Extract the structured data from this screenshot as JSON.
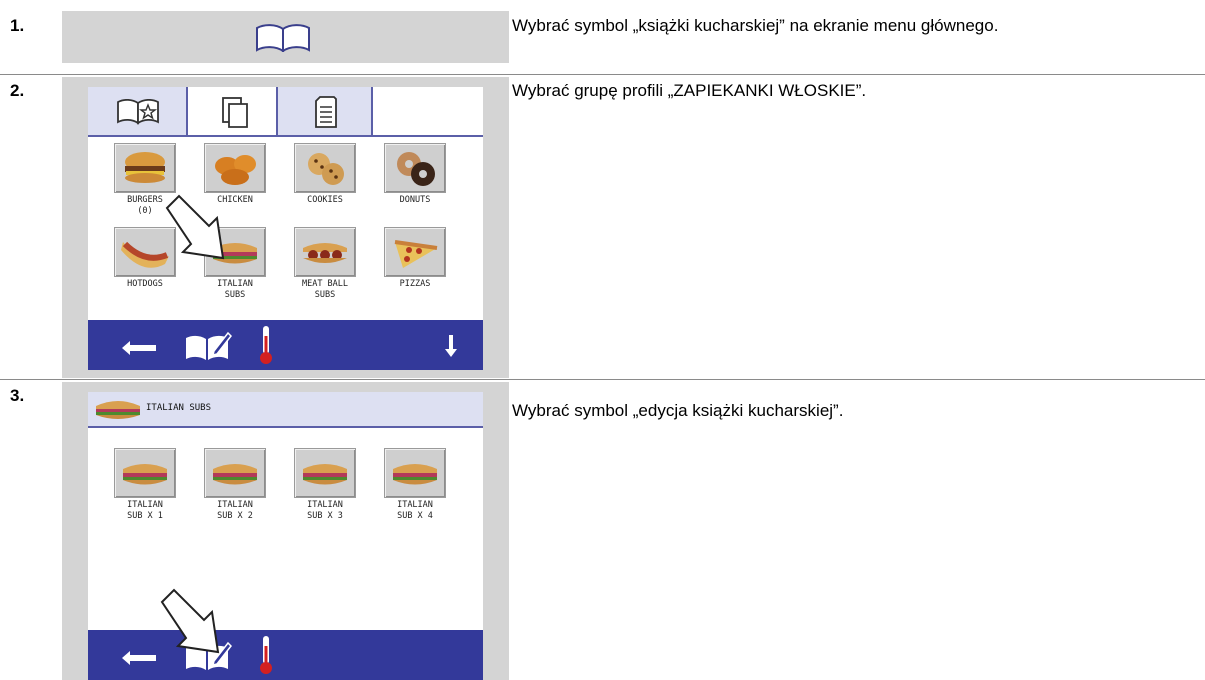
{
  "steps": [
    {
      "number": "1.",
      "text": "Wybrać symbol „książki kucharskiej” na ekranie menu głównego."
    },
    {
      "number": "2.",
      "text": "Wybrać grupę profili „ZAPIEKANKI WŁOSKIE”."
    },
    {
      "number": "3.",
      "text": "Wybrać symbol „edycja książki kucharskiej”."
    }
  ],
  "screen2": {
    "tiles": [
      {
        "label": "BURGERS\n(0)",
        "icon": "burger-icon"
      },
      {
        "label": "CHICKEN",
        "icon": "chicken-icon"
      },
      {
        "label": "COOKIES",
        "icon": "cookies-icon"
      },
      {
        "label": "DONUTS",
        "icon": "donuts-icon"
      },
      {
        "label": "HOTDOGS",
        "icon": "hotdog-icon"
      },
      {
        "label": "ITALIAN\nSUBS",
        "icon": "sub-sandwich-icon"
      },
      {
        "label": "MEAT BALL\nSUBS",
        "icon": "meatball-sub-icon"
      },
      {
        "label": "PIZZAS",
        "icon": "pizza-icon"
      }
    ]
  },
  "screen3": {
    "header_title": "ITALIAN SUBS",
    "tiles": [
      {
        "label": "ITALIAN\nSUB X 1"
      },
      {
        "label": "ITALIAN\nSUB X 2"
      },
      {
        "label": "ITALIAN\nSUB X 3"
      },
      {
        "label": "ITALIAN\nSUB X 4"
      }
    ]
  },
  "colors": {
    "bar": "#33399a",
    "tab_border": "#5b5fa8",
    "tab_bg": "#dde0f2",
    "panel_bg": "#d4d4d4",
    "thermo": "#d42020"
  }
}
